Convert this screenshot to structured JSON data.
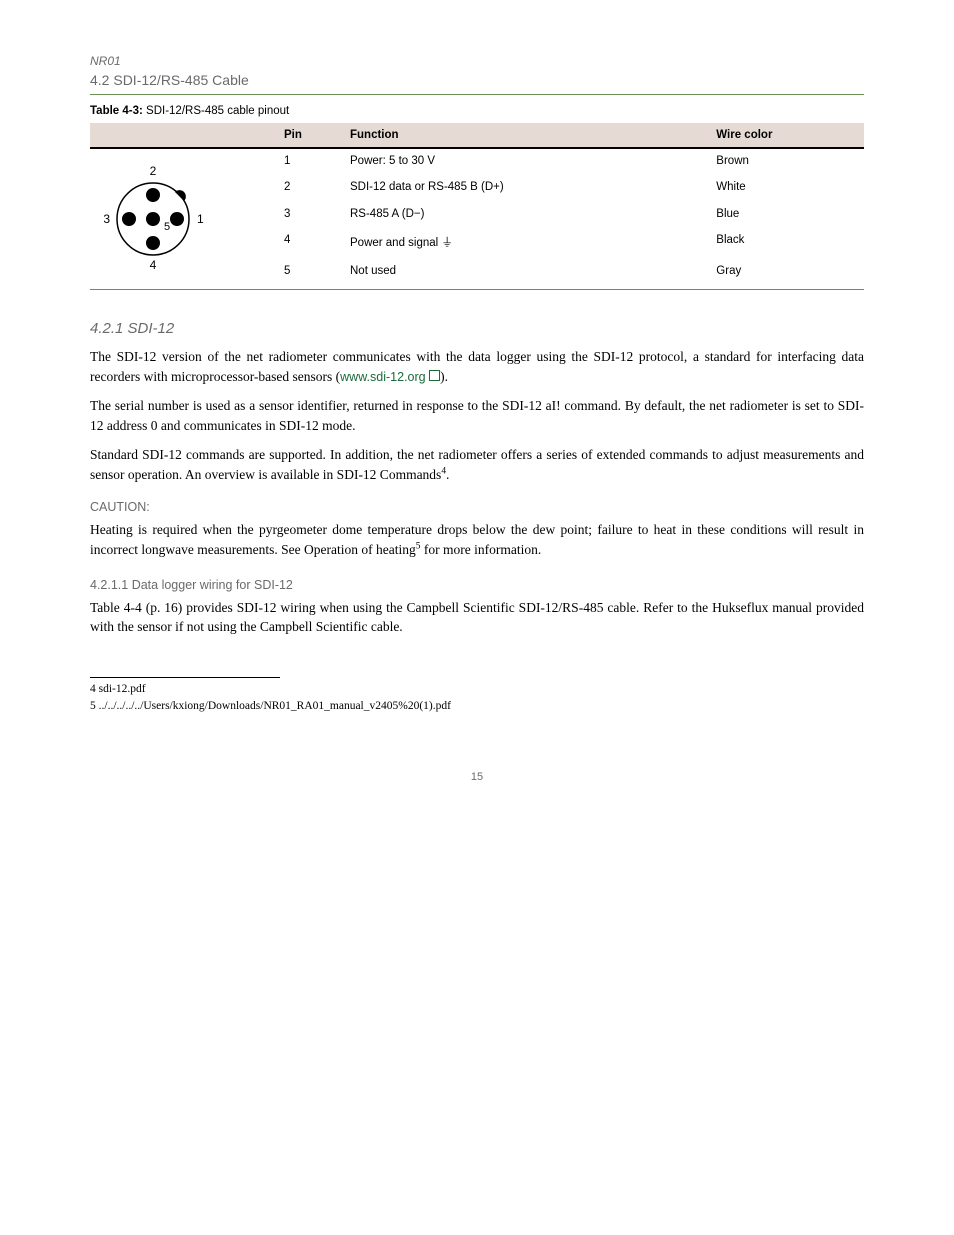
{
  "header": {
    "running_head": "NR01",
    "section": "4.2 SDI-12/RS-485 Cable"
  },
  "table": {
    "caption_num": "Table 4-3:",
    "caption_text": "SDI-12/RS-485 cable pinout",
    "headers": [
      "",
      "Pin",
      "Function",
      "Wire color"
    ],
    "rows": [
      [
        "1",
        "Power: 5 to 30 V",
        "Brown"
      ],
      [
        "2",
        "SDI-12 data or RS-485 B (D+)",
        "White"
      ],
      [
        "3",
        "RS-485 A (D−)",
        "Blue"
      ],
      [
        "4",
        "Power and signal ⏚",
        "Black"
      ],
      [
        "5",
        "Not used",
        "Gray"
      ]
    ],
    "diagram_labels": {
      "top": "2",
      "right": "1",
      "bottom": "4",
      "left": "3",
      "center": "5"
    }
  },
  "sections": {
    "sdi12": {
      "title": "4.2.1 SDI-12",
      "wiring_title": "4.2.1.1 Data logger wiring for SDI-12",
      "p1_a": "The SDI-12 version of the net radiometer communicates with the data logger using the SDI-12 protocol, a standard for interfacing data recorders with microprocessor-based sensors (",
      "p1_link": "www.sdi-12.org",
      "p1_b": ").",
      "p2": "The serial number is used as a sensor identifier, returned in response to the SDI-12 aI! command. By default, the net radiometer is set to SDI-12 address 0 and communicates in SDI-12 mode.",
      "p3_a": "Standard SDI-12 commands are supported. In addition, the net radiometer offers a series of extended commands to adjust measurements and sensor operation. An overview is available in SDI-12 Commands",
      "p3_fn": "4",
      "p3_b": "."
    },
    "caution": {
      "label": "CAUTION:",
      "text_a": "Heating is required when the pyrgeometer dome temperature drops below the dew point; failure to heat in these conditions will result in incorrect longwave measurements. See Operation of heating",
      "text_fn": "5",
      "text_b": " for more information."
    },
    "wiring_para": "Table 4-4 (p. 16) provides SDI-12 wiring when using the Campbell Scientific SDI-12/RS-485 cable. Refer to the Hukseflux manual provided with the sensor if not using the Campbell Scientific cable."
  },
  "footnotes": {
    "f4": "4 sdi-12.pdf",
    "f5": "5 ../../../../../Users/kxiong/Downloads/NR01_RA01_manual_v2405%20(1).pdf"
  },
  "page_number": "15"
}
